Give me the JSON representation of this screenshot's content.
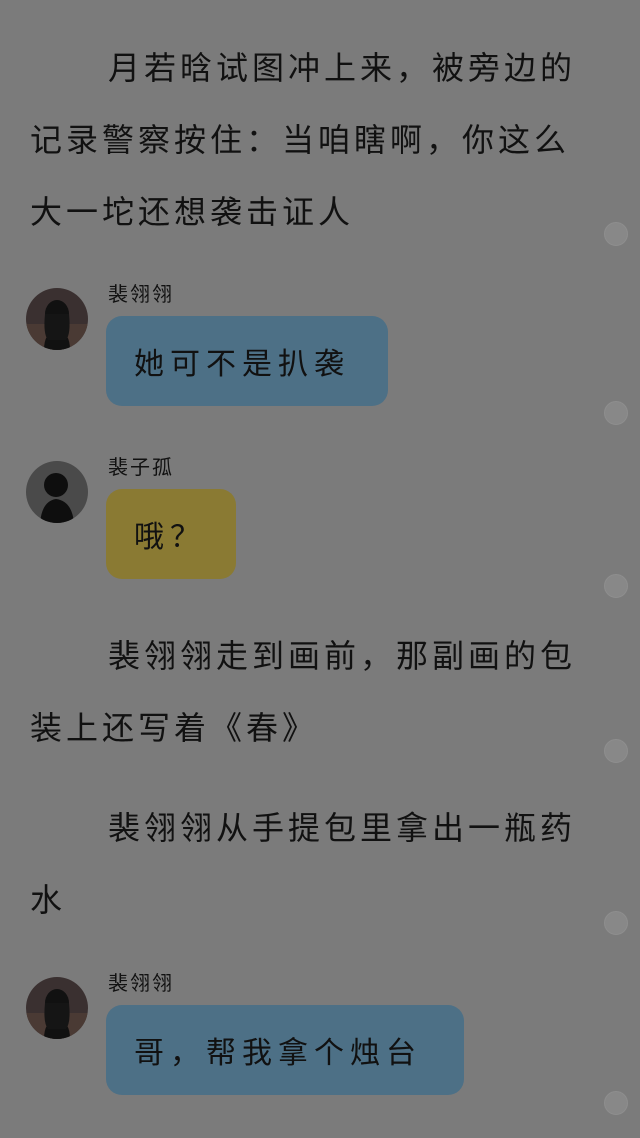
{
  "narrations": [
    "月若晗试图冲上来，被旁边的记录警察按住：当咱瞎啊，你这么大一坨还想袭击证人",
    "裴翎翎走到画前，那副画的包装上还写着《春》",
    "裴翎翎从手提包里拿出一瓶药水"
  ],
  "messages": [
    {
      "sender": "裴翎翎",
      "text": "她可不是扒袭",
      "avatar": "girl-avatar",
      "color": "#4d7086"
    },
    {
      "sender": "裴子孤",
      "text": "哦？",
      "avatar": "silhouette-avatar",
      "color": "#8a7a33"
    },
    {
      "sender": "裴翎翎",
      "text": "哥，帮我拿个烛台",
      "avatar": "girl-avatar",
      "color": "#4d7086"
    }
  ],
  "colors": {
    "background": "#7b7b7b",
    "bubble_blue": "#4d7086",
    "bubble_yellow": "#8a7a33"
  }
}
